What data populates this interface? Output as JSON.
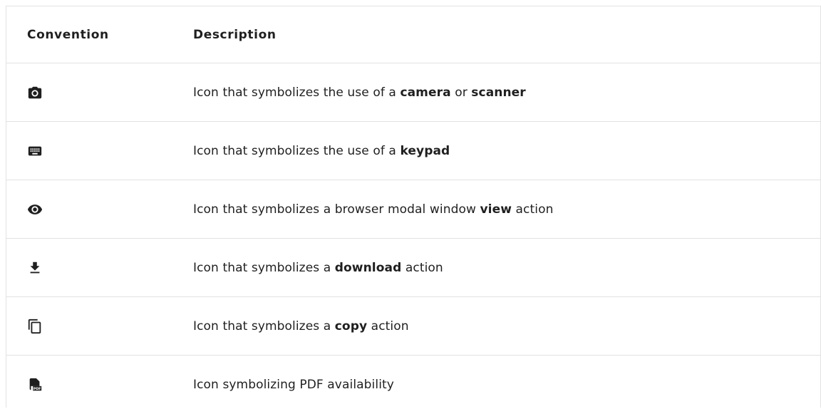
{
  "table": {
    "headers": {
      "convention": "Convention",
      "description": "Description"
    },
    "rows": [
      {
        "icon": "camera-icon",
        "parts": [
          "Icon that symbolizes the use of a ",
          "camera",
          " or ",
          "scanner",
          ""
        ]
      },
      {
        "icon": "keyboard-icon",
        "parts": [
          "Icon that symbolizes the use of a ",
          "keypad",
          ""
        ]
      },
      {
        "icon": "eye-icon",
        "parts": [
          "Icon that symbolizes a browser modal window ",
          "view",
          " action"
        ]
      },
      {
        "icon": "download-icon",
        "parts": [
          "Icon that symbolizes a ",
          "download",
          " action"
        ]
      },
      {
        "icon": "copy-icon",
        "parts": [
          "Icon that symbolizes a ",
          "copy",
          " action"
        ]
      },
      {
        "icon": "pdf-icon",
        "parts": [
          "Icon symbolizing PDF availability"
        ]
      }
    ]
  }
}
